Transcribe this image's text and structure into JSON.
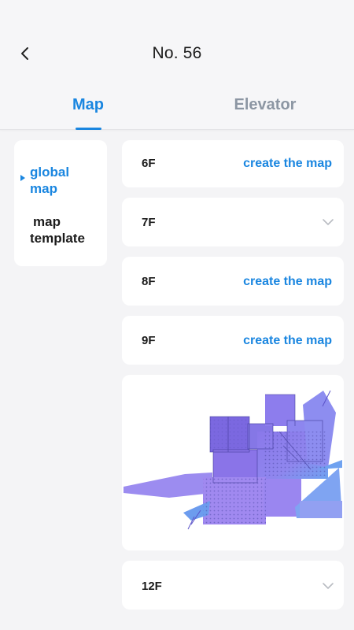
{
  "header": {
    "title": "No. 56",
    "tabs": {
      "map": "Map",
      "elevator": "Elevator"
    }
  },
  "sidebar": {
    "items": [
      {
        "line1": "global",
        "line2": "map"
      },
      {
        "line1": "map",
        "line2": "template"
      }
    ]
  },
  "floors": [
    {
      "label": "6F",
      "action": "create the map"
    },
    {
      "label": "7F"
    },
    {
      "label": "8F",
      "action": "create the map"
    },
    {
      "label": "9F",
      "action": "create the map"
    },
    {
      "label": "12F"
    }
  ],
  "colors": {
    "accent": "#1a86e0",
    "inactive_tab": "#8c96a3",
    "map_purple": "#8a78ea",
    "map_blue": "#6fa2f0"
  },
  "icons": {
    "back": "chevron-left-icon",
    "expand": "chevron-down-icon",
    "active_marker": "triangle-right-icon"
  }
}
